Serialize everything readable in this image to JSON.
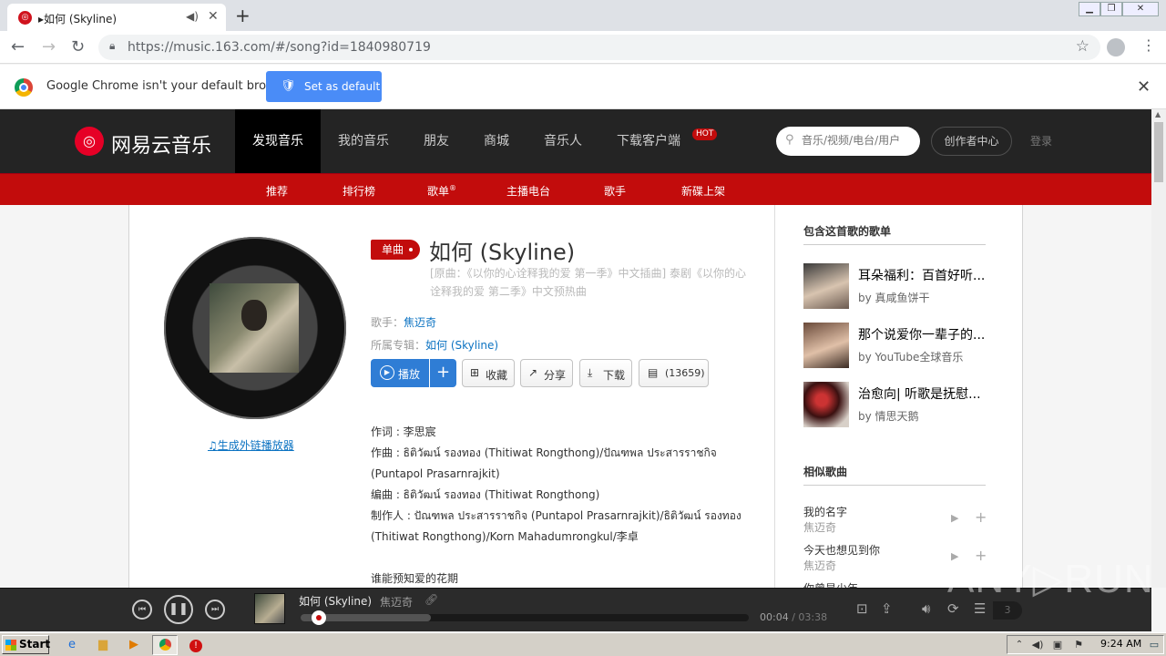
{
  "browser": {
    "tab_title": "▸如何 (Skyline)",
    "url": "https://music.163.com/#/song?id=1840980719",
    "infobar_message": "Google Chrome isn't your default browser",
    "infobar_button": "Set as default"
  },
  "site": {
    "logo_text": "网易云音乐",
    "nav": [
      {
        "label": "发现音乐",
        "active": true
      },
      {
        "label": "我的音乐"
      },
      {
        "label": "朋友"
      },
      {
        "label": "商城"
      },
      {
        "label": "音乐人"
      },
      {
        "label": "下载客户端"
      }
    ],
    "hot_badge": "HOT",
    "search_placeholder": "音乐/视频/电台/用户",
    "creator_button": "创作者中心",
    "login": "登录",
    "subnav": [
      "推荐",
      "排行榜",
      "歌单",
      "主播电台",
      "歌手",
      "新碟上架"
    ],
    "subnav_reg": "®"
  },
  "song": {
    "type_badge": "单曲",
    "title": "如何 (Skyline)",
    "subtitle": "[原曲：《以你的心诠释我的爱 第一季》中文插曲] 泰剧《以你的心诠释我的爱 第二季》中文预热曲",
    "singer_label": "歌手：",
    "singer": "焦迈奇",
    "album_label": "所属专辑：",
    "album": "如何 (Skyline)",
    "generate_player_link": "生成外链播放器",
    "buttons": {
      "play": "播放",
      "add": "+",
      "collect": "收藏",
      "share": "分享",
      "download": "下载",
      "comments": "(13659)"
    },
    "lyrics": [
      "作词 : 李思宸",
      "作曲 : ธิติวัฒน์ รองทอง (Thitiwat Rongthong)/ปัณฑพล ประสารราชกิจ (Puntapol Prasarnrajkit)",
      "编曲 : ธิติวัฒน์ รองทอง (Thitiwat Rongthong)",
      "制作人 : ปัณฑพล ประสารราชกิจ (Puntapol Prasarnrajkit)/ธิติวัฒน์ รองทอง (Thitiwat Rongthong)/Korn Mahadumrongkul/李卓",
      "",
      "谁能预知爱的花期"
    ]
  },
  "sidebar": {
    "playlists_heading": "包含这首歌的歌单",
    "playlists": [
      {
        "title": "耳朵福利：百首好听...",
        "by": "by",
        "author": "真咸鱼饼干"
      },
      {
        "title": "那个说爱你一辈子的...",
        "by": "by",
        "author": "YouTube全球音乐"
      },
      {
        "title": "治愈向| 听歌是抚慰...",
        "by": "by",
        "author": "情思天鹅"
      }
    ],
    "similar_heading": "相似歌曲",
    "similar": [
      {
        "name": "我的名字",
        "artist": "焦迈奇"
      },
      {
        "name": "今天也想见到你",
        "artist": "焦迈奇"
      },
      {
        "name": "你曾是少年",
        "artist": ""
      }
    ]
  },
  "player": {
    "title": "如何 (Skyline)",
    "artist": "焦迈奇",
    "current_time": "00:04",
    "total_time": "/ 03:38",
    "progress": 0.02,
    "buffered": 0.29,
    "playlist_count": "3"
  },
  "watermark": "ANY▷RUN",
  "taskbar": {
    "start": "Start",
    "clock": "9:24 AM"
  },
  "colors": {
    "netease_red": "#c20c0c",
    "topbar": "#242424",
    "link_blue": "#0c73c2",
    "play_blue": "#2f7dd5"
  }
}
